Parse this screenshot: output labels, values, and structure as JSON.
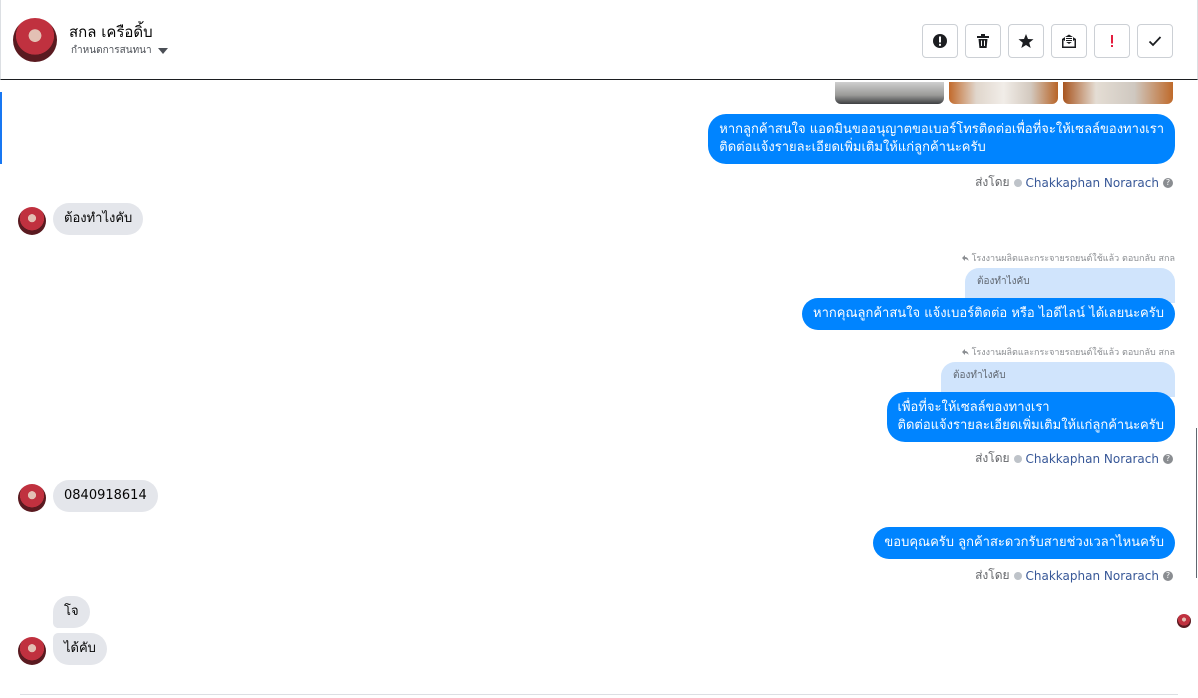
{
  "header": {
    "contact_name": "สกล เครือดิ้บ",
    "label_dropdown": "กำหนดการสนทนา",
    "actions": [
      {
        "name": "mark-spam-button",
        "icon": "alert-circle-icon"
      },
      {
        "name": "delete-button",
        "icon": "trash-icon"
      },
      {
        "name": "star-button",
        "icon": "star-icon"
      },
      {
        "name": "mark-unread-button",
        "icon": "envelope-icon"
      },
      {
        "name": "mark-important-button",
        "icon": "exclamation-icon"
      },
      {
        "name": "mark-done-button",
        "icon": "check-icon"
      }
    ]
  },
  "messages": {
    "m1": {
      "line1": "หากลูกค้าสนใจ แอดมินขออนุญาตขอเบอร์โทรติดต่อเพื่อที่จะให้เซลล์ของทางเรา",
      "line2": "ติดต่อแจ้งรายละเอียดเพิ่มเติมให้แก่ลูกค้านะครับ"
    },
    "sent_by_1": {
      "prefix": "ส่งโดย",
      "agent": "Chakkaphan Norarach"
    },
    "m2": {
      "text": "ต้องทำไงคับ"
    },
    "reply_hdr_1": "โรงงานผลิตและกระจายรถยนต์ใช้แล้ว ตอบกลับ สกล",
    "quote_1": "ต้องทำไงคับ",
    "m3": {
      "text": "หากคุณลูกค้าสนใจ แจ้งเบอร์ติดต่อ หรือ ไอดีไลน์ ได้เลยนะครับ"
    },
    "reply_hdr_2": "โรงงานผลิตและกระจายรถยนต์ใช้แล้ว ตอบกลับ สกล",
    "quote_2": "ต้องทำไงคับ",
    "m4": {
      "line1": "เพื่อที่จะให้เซลล์ของทางเรา",
      "line2": "ติดต่อแจ้งรายละเอียดเพิ่มเติมให้แก่ลูกค้านะครับ"
    },
    "sent_by_2": {
      "prefix": "ส่งโดย",
      "agent": "Chakkaphan Norarach"
    },
    "m5": {
      "text": "0840918614"
    },
    "m6": {
      "text": "ขอบคุณครับ ลูกค้าสะดวกรับสายช่วงเวลาไหนครับ"
    },
    "sent_by_3": {
      "prefix": "ส่งโดย",
      "agent": "Chakkaphan Norarach"
    },
    "m7": {
      "text": "โจ"
    },
    "m8": {
      "text": "ได้คับ"
    }
  },
  "colors": {
    "outgoing_bubble": "#0084ff",
    "incoming_bubble": "#e4e6eb",
    "quote_bubble": "#d0e4fc",
    "agent_link": "#385898"
  }
}
